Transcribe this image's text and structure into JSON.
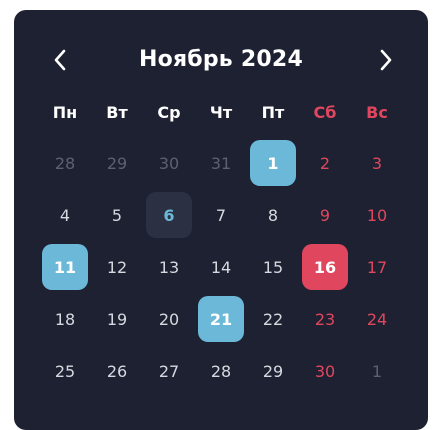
{
  "calendar": {
    "month": "Ноябрь",
    "year": "2024",
    "weekdays": [
      {
        "label": "Пн",
        "weekend": false
      },
      {
        "label": "Вт",
        "weekend": false
      },
      {
        "label": "Ср",
        "weekend": false
      },
      {
        "label": "Чт",
        "weekend": false
      },
      {
        "label": "Пт",
        "weekend": false
      },
      {
        "label": "Сб",
        "weekend": true
      },
      {
        "label": "Вс",
        "weekend": true
      }
    ],
    "days": [
      {
        "label": "28",
        "outside": true
      },
      {
        "label": "29",
        "outside": true
      },
      {
        "label": "30",
        "outside": true
      },
      {
        "label": "31",
        "outside": true
      },
      {
        "label": "1",
        "state": "selected"
      },
      {
        "label": "2",
        "weekend": true
      },
      {
        "label": "3",
        "weekend": true
      },
      {
        "label": "4"
      },
      {
        "label": "5"
      },
      {
        "label": "6",
        "state": "today"
      },
      {
        "label": "7"
      },
      {
        "label": "8"
      },
      {
        "label": "9",
        "weekend": true
      },
      {
        "label": "10",
        "weekend": true
      },
      {
        "label": "11",
        "state": "selected"
      },
      {
        "label": "12"
      },
      {
        "label": "13"
      },
      {
        "label": "14"
      },
      {
        "label": "15"
      },
      {
        "label": "16",
        "weekend": true,
        "state": "holiday"
      },
      {
        "label": "17",
        "weekend": true
      },
      {
        "label": "18"
      },
      {
        "label": "19"
      },
      {
        "label": "20"
      },
      {
        "label": "21",
        "state": "selected"
      },
      {
        "label": "22"
      },
      {
        "label": "23",
        "weekend": true
      },
      {
        "label": "24",
        "weekend": true
      },
      {
        "label": "25"
      },
      {
        "label": "26"
      },
      {
        "label": "27"
      },
      {
        "label": "28"
      },
      {
        "label": "29"
      },
      {
        "label": "30",
        "weekend": true
      },
      {
        "label": "1",
        "weekend": true,
        "outside": true
      }
    ]
  },
  "icons": {
    "prev": "chevron-left-icon",
    "next": "chevron-right-icon"
  },
  "colors": {
    "background": "#1d2131",
    "text": "#d7d9e0",
    "muted": "#5c6170",
    "weekend": "#e0475f",
    "selected": "#6cb8d8",
    "today_bg": "#2b3142"
  }
}
